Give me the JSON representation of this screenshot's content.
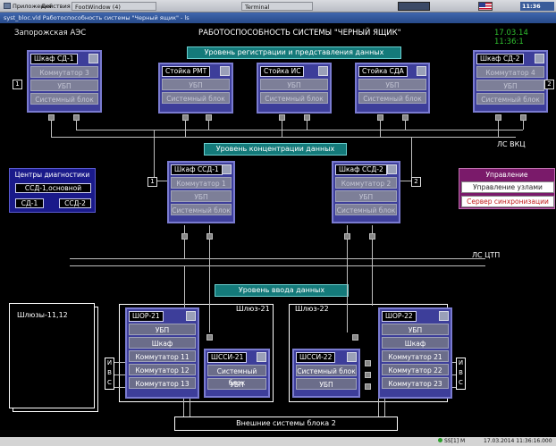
{
  "desktop": {
    "apps_label": "Приложения",
    "actions_label": "Действия",
    "task1": "FootWindow (4)",
    "task2": "Terminal",
    "clock": "11:36"
  },
  "window": {
    "title": "syst_bloc.vld Работоспособность системы \"Черный ящик\" - ls"
  },
  "header": {
    "station": "Запорожская АЭС",
    "title": "РАБОТОСПОСОБНОСТЬ СИСТЕМЫ \"ЧЕРНЫЙ ЯЩИК\"",
    "timestamp": "17.03.14 11:36:1"
  },
  "banners": {
    "registration": "Уровень регистрации и представления данных",
    "concentration": "Уровень концентрации данных",
    "input": "Уровень ввода данных"
  },
  "panels": {
    "sd1": {
      "title": "Шкаф СД-1",
      "b1": "Коммутатор 3",
      "b2": "УБП",
      "b3": "Системный блок"
    },
    "rmt": {
      "title": "Стойка РМТ",
      "b1": "УБП",
      "b2": "Системный блок"
    },
    "is": {
      "title": "Стойка ИС",
      "b1": "УБП",
      "b2": "Системный блок"
    },
    "sda": {
      "title": "Стойка СДА",
      "b1": "УБП",
      "b2": "Системный блок"
    },
    "sd2": {
      "title": "Шкаф СД-2",
      "b1": "Коммутатор 4",
      "b2": "УБП",
      "b3": "Системный блок"
    },
    "ssd1": {
      "title": "Шкаф ССД-1",
      "b1": "Коммутатор 1",
      "b2": "УБП",
      "b3": "Системный блок"
    },
    "ssd2": {
      "title": "Шкаф ССД-2",
      "b1": "Коммутатор 2",
      "b2": "УБП",
      "b3": "Системный блок"
    },
    "shor21": {
      "title": "ШОР-21",
      "b1": "УБП",
      "b2": "Шкаф",
      "b3": "Коммутатор 11",
      "b4": "Коммутатор 12",
      "b5": "Коммутатор 13"
    },
    "shssi21": {
      "title": "ШССИ-21",
      "b1": "Системный блок",
      "b2": "УБП"
    },
    "shssi22": {
      "title": "ШССИ-22",
      "b1": "Системный блок",
      "b2": "УБП"
    },
    "shor22": {
      "title": "ШОР-22",
      "b1": "УБП",
      "b2": "Шкаф",
      "b3": "Коммутатор 21",
      "b4": "Коммутатор 22",
      "b5": "Коммутатор 23"
    }
  },
  "side_labels": {
    "left_top": "1",
    "right_top": "2",
    "left_mid": "1",
    "right_mid": "2"
  },
  "lans": {
    "vkc": "ЛС ВКЦ",
    "ctp": "ЛС ЦТП"
  },
  "diagnostics": {
    "title": "Центры диагностики",
    "main": "ССД-1,основной",
    "sd1": "СД-1",
    "ssd2": "ССД-2"
  },
  "management": {
    "title": "Управление",
    "nodes": "Управление узлами",
    "sync": "Сервер синхронизации"
  },
  "gateways": {
    "g1112": "Шлюзы-11,12",
    "g21": "Шлюз-21",
    "g22": "Шлюз-22"
  },
  "ivs": {
    "i": "И",
    "v": "В",
    "s": "С"
  },
  "external": "Внешние системы блока 2",
  "status": {
    "host": "SS[1] M",
    "datetime": "17.03.2014 11:36:16.000"
  },
  "colors": {
    "background": "#000000",
    "panel": "#3d3e9a",
    "banner": "#147a7a",
    "timestamp": "#2fbf2f",
    "management": "#7a1a6a",
    "diagnostics": "#1a1a8a"
  }
}
